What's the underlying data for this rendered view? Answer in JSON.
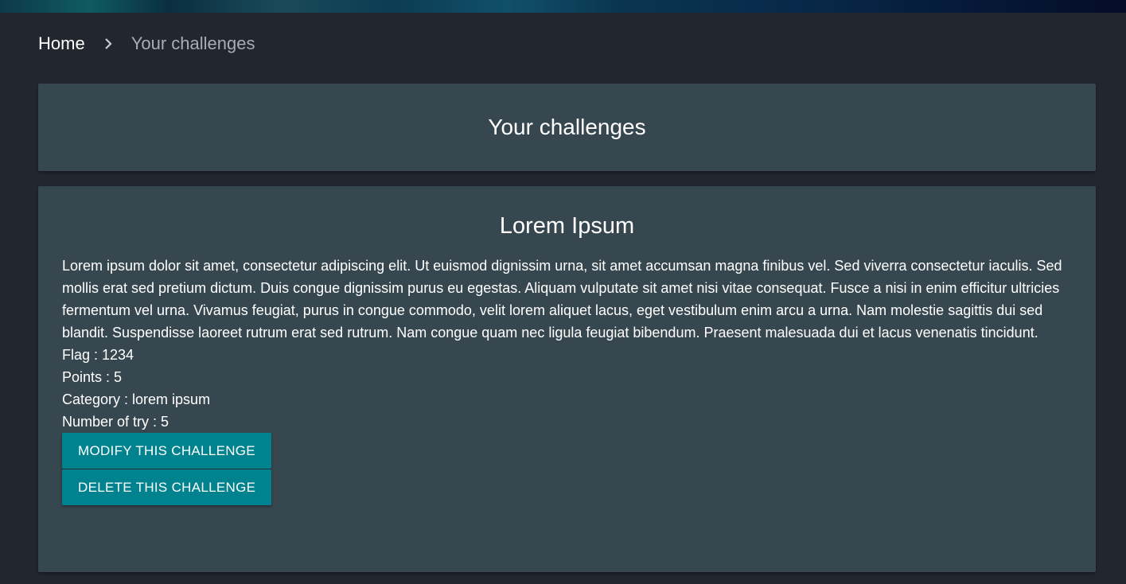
{
  "breadcrumb": {
    "home_label": "Home",
    "separator_icon": "chevron-right-icon",
    "current_label": "Your challenges"
  },
  "page": {
    "title": "Your challenges"
  },
  "challenge": {
    "title": "Lorem Ipsum",
    "description": "Lorem ipsum dolor sit amet, consectetur adipiscing elit. Ut euismod dignissim urna, sit amet accumsan magna finibus vel. Sed viverra consectetur iaculis. Sed mollis erat sed pretium dictum. Duis congue dignissim purus eu egestas. Aliquam vulputate sit amet nisi vitae consequat. Fusce a nisi in enim efficitur ultricies fermentum vel urna. Vivamus feugiat, purus in congue commodo, velit lorem aliquet lacus, eget vestibulum enim arcu a urna. Nam molestie sagittis dui sed blandit. Suspendisse laoreet rutrum erat sed rutrum. Nam congue quam nec ligula feugiat bibendum. Praesent malesuada dui et lacus venenatis tincidunt.",
    "flag_line": "Flag : 1234",
    "points_line": "Points : 5",
    "category_line": "Category : lorem ipsum",
    "tries_line": "Number of try : 5",
    "modify_label": "Modify this challenge",
    "delete_label": "Delete this challenge"
  },
  "colors": {
    "background": "#22262e",
    "card": "#37474f",
    "accent_button": "#00838f",
    "breadcrumb_muted": "#a9adb3"
  }
}
